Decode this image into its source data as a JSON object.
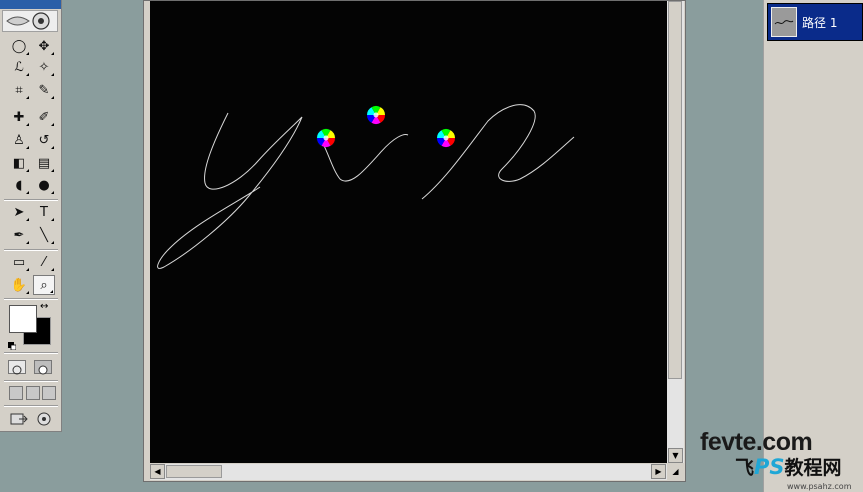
{
  "toolbox": {
    "tools": [
      {
        "name": "marquee-tool",
        "glyph": "◯"
      },
      {
        "name": "move-tool",
        "glyph": "✥"
      },
      {
        "name": "lasso-tool",
        "glyph": "ℒ"
      },
      {
        "name": "magic-wand-tool",
        "glyph": "✧"
      },
      {
        "name": "crop-tool",
        "glyph": "⌗"
      },
      {
        "name": "slice-tool",
        "glyph": "✎"
      },
      {
        "name": "healing-brush-tool",
        "glyph": "✚"
      },
      {
        "name": "brush-tool",
        "glyph": "✐"
      },
      {
        "name": "clone-stamp-tool",
        "glyph": "♙"
      },
      {
        "name": "history-brush-tool",
        "glyph": "↺"
      },
      {
        "name": "eraser-tool",
        "glyph": "◧"
      },
      {
        "name": "gradient-tool",
        "glyph": "▤"
      },
      {
        "name": "blur-tool",
        "glyph": "◖"
      },
      {
        "name": "dodge-tool",
        "glyph": "●"
      },
      {
        "name": "path-selection-tool",
        "glyph": "➤"
      },
      {
        "name": "type-tool",
        "glyph": "T"
      },
      {
        "name": "pen-tool",
        "glyph": "✒"
      },
      {
        "name": "line-tool",
        "glyph": "╲"
      },
      {
        "name": "notes-tool",
        "glyph": "▭"
      },
      {
        "name": "eyedropper-tool",
        "glyph": "⁄"
      },
      {
        "name": "hand-tool",
        "glyph": "✋"
      },
      {
        "name": "zoom-tool",
        "glyph": "⌕"
      }
    ],
    "foreground_color": "#ffffff",
    "background_color": "#000000"
  },
  "paths_panel": {
    "path_name": "路径 1",
    "selection_color": "#0a2b8a"
  },
  "document": {
    "canvas_color": "#040404",
    "artwork_text": "yin"
  },
  "watermark": {
    "domain": "fevte.com",
    "cn_prefix": "飞",
    "cn_ps": "PS",
    "cn_suffix": "教程网",
    "url": "www.psahz.com"
  }
}
